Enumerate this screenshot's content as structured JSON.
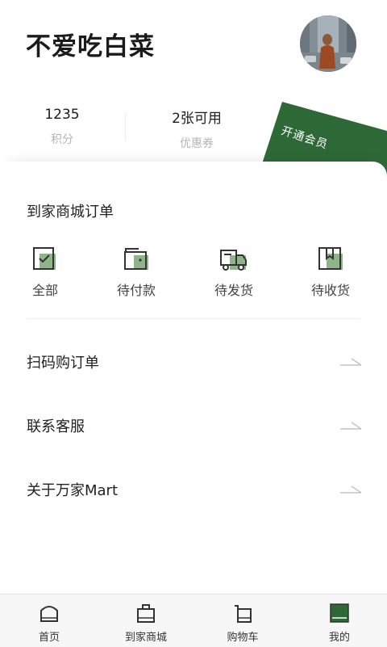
{
  "profile": {
    "username": "不爱吃白菜"
  },
  "stats": {
    "points_value": "1235",
    "points_label": "积分",
    "coupons_value": "2张可用",
    "coupons_label": "优惠券"
  },
  "membership": {
    "label": "开通会员",
    "color": "#2d6936"
  },
  "orders": {
    "title": "到家商城订单",
    "items": [
      {
        "label": "全部",
        "icon": "all-orders-icon"
      },
      {
        "label": "待付款",
        "icon": "wallet-icon"
      },
      {
        "label": "待发货",
        "icon": "truck-icon"
      },
      {
        "label": "待收货",
        "icon": "package-icon"
      }
    ]
  },
  "menu": {
    "items": [
      {
        "label": "扫码购订单"
      },
      {
        "label": "联系客服"
      },
      {
        "label": "关于万家Mart"
      }
    ]
  },
  "tabbar": {
    "items": [
      {
        "label": "首页",
        "icon": "home-icon"
      },
      {
        "label": "到家商城",
        "icon": "shopping-bag-icon"
      },
      {
        "label": "购物车",
        "icon": "cart-icon"
      },
      {
        "label": "我的",
        "icon": "profile-icon",
        "active": true
      }
    ]
  },
  "colors": {
    "accent_green": "#2d6936",
    "icon_green": "#8fb48a"
  }
}
